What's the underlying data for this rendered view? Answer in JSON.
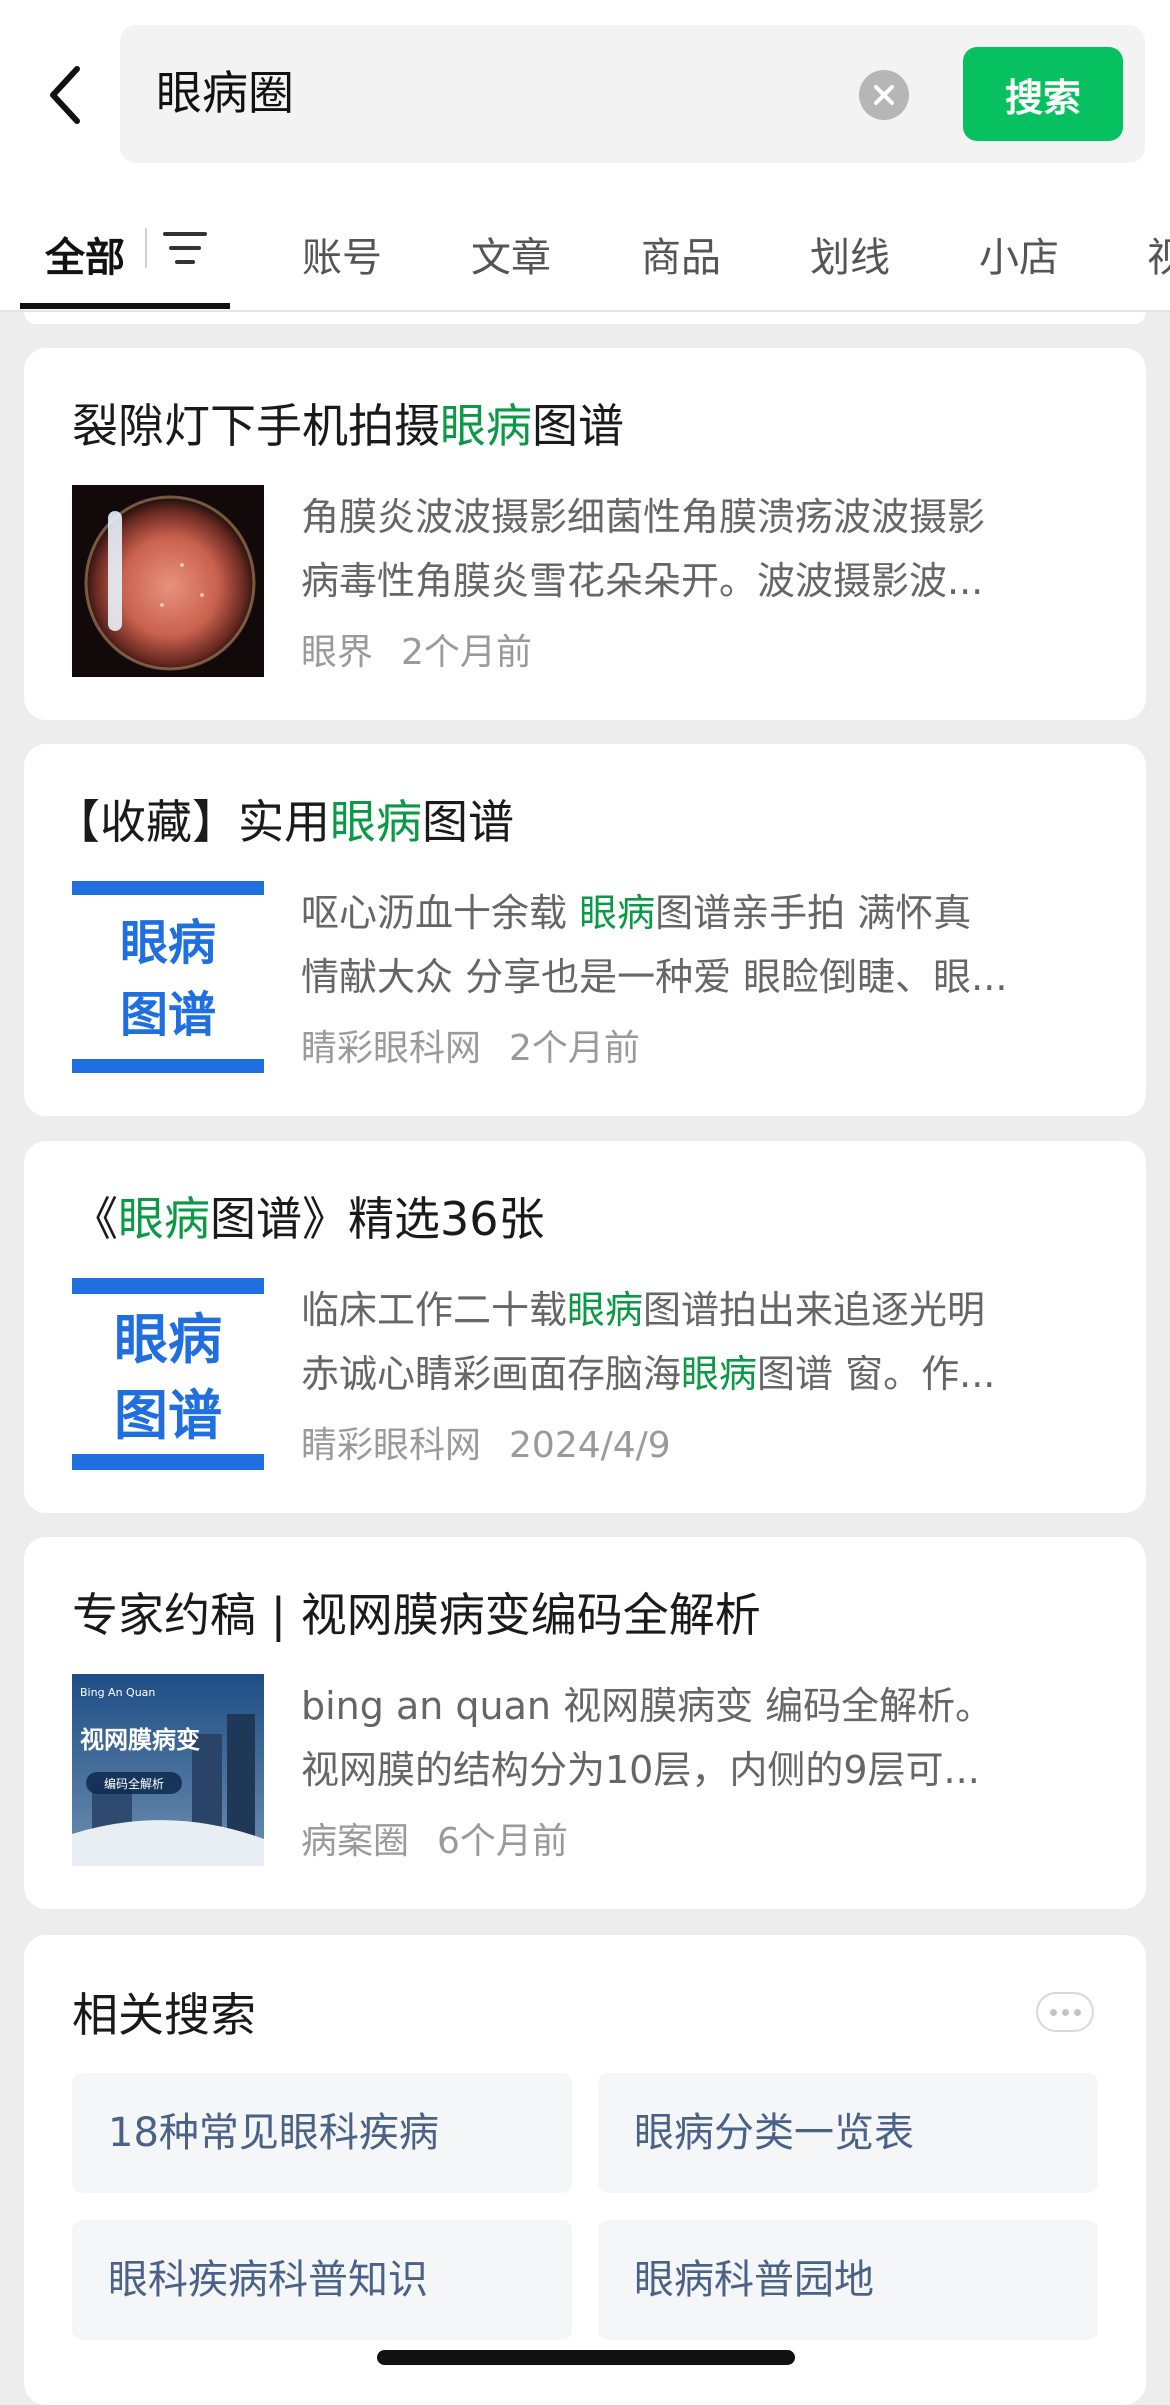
{
  "search": {
    "query": "眼病圈",
    "button_label": "搜索"
  },
  "tabs": [
    {
      "label": "全部"
    },
    {
      "label": "账号"
    },
    {
      "label": "文章"
    },
    {
      "label": "商品"
    },
    {
      "label": "划线"
    },
    {
      "label": "小店"
    },
    {
      "label": "视"
    }
  ],
  "highlight_color": "#0a9a45",
  "accent_color": "#07c160",
  "results": [
    {
      "title_pre": "裂隙灯下手机拍摄",
      "title_hl": "眼病",
      "title_post": "图谱",
      "snippet_line1": "角膜炎波波摄影细菌性角膜溃疡波波摄影",
      "snippet_line2": "病毒性角膜炎雪花朵朵开。波波摄影波...",
      "source": "眼界",
      "time": "2个月前"
    },
    {
      "title_pre": "【收藏】实用",
      "title_hl": "眼病",
      "title_post": "图谱",
      "thumb_text_1": "眼病",
      "thumb_text_2": "图谱",
      "snippet_line1_a": "呕心沥血十余载 ",
      "snippet_line1_hl": "眼病",
      "snippet_line1_b": "图谱亲手拍 满怀真",
      "snippet_line2": "情献大众 分享也是一种爱 眼睑倒睫、眼...",
      "source": "睛彩眼科网",
      "time": "2个月前"
    },
    {
      "title_pre": "《",
      "title_hl": "眼病",
      "title_post": "图谱》精选36张",
      "thumb_text_1": "眼病",
      "thumb_text_2": "图谱",
      "snippet_line1_a": "临床工作二十载",
      "snippet_line1_hl": "眼病",
      "snippet_line1_b": "图谱拍出来追逐光明",
      "snippet_line2_a": "赤诚心睛彩画面存脑海",
      "snippet_line2_hl": "眼病",
      "snippet_line2_b": "图谱 窗。作...",
      "source": "睛彩眼科网",
      "time": "2024/4/9"
    },
    {
      "title": "专家约稿 | 视网膜病变编码全解析",
      "thumb_small": "Bing An Quan",
      "thumb_text": "视网膜病变",
      "thumb_tag": "编码全解析",
      "snippet_line1": "bing an quan 视网膜病变 编码全解析。",
      "snippet_line2": "视网膜的结构分为10层，内侧的9层可...",
      "source": "病案圈",
      "time": "6个月前"
    }
  ],
  "related": {
    "title": "相关搜索",
    "items": [
      "18种常见眼科疾病",
      "眼病分类一览表",
      "眼科疾病科普知识",
      "眼病科普园地"
    ]
  }
}
